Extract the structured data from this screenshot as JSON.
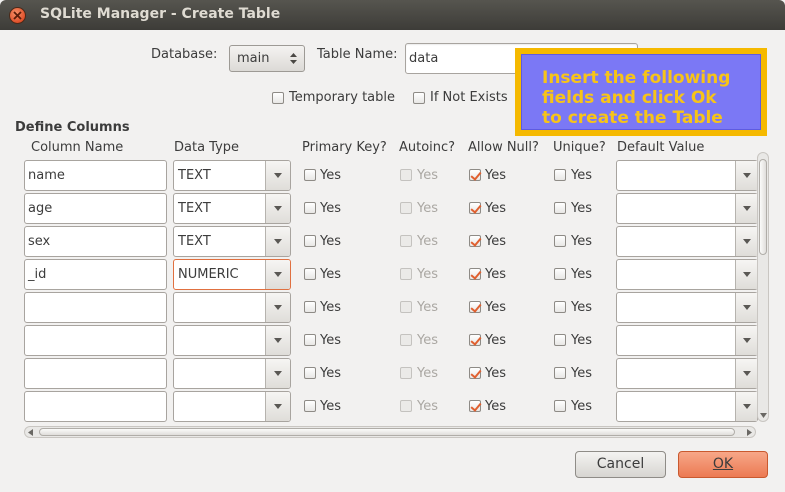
{
  "window": {
    "title": "SQLite Manager - Create Table"
  },
  "form": {
    "database_label": "Database:",
    "database_value": "main",
    "table_name_label": "Table Name:",
    "table_name_value": "data",
    "temporary_label": "Temporary table",
    "if_not_exists_label": "If Not Exists"
  },
  "tooltip": {
    "text": "Insert the following\nfields and click Ok\nto create the Table"
  },
  "columns_section": {
    "title": "Define Columns",
    "headers": [
      "Column Name",
      "Data Type",
      "Primary Key?",
      "Autoinc?",
      "Allow Null?",
      "Unique?",
      "Default Value"
    ],
    "yes_label": "Yes",
    "rows": [
      {
        "name": "name",
        "type": "TEXT",
        "primary_key": false,
        "autoinc": false,
        "allow_null": true,
        "unique": false,
        "default": ""
      },
      {
        "name": "age",
        "type": "TEXT",
        "primary_key": false,
        "autoinc": false,
        "allow_null": true,
        "unique": false,
        "default": ""
      },
      {
        "name": "sex",
        "type": "TEXT",
        "primary_key": false,
        "autoinc": false,
        "allow_null": true,
        "unique": false,
        "default": ""
      },
      {
        "name": "_id",
        "type": "NUMERIC",
        "primary_key": false,
        "autoinc": false,
        "allow_null": true,
        "unique": false,
        "default": ""
      },
      {
        "name": "",
        "type": "",
        "primary_key": false,
        "autoinc": false,
        "allow_null": true,
        "unique": false,
        "default": ""
      },
      {
        "name": "",
        "type": "",
        "primary_key": false,
        "autoinc": false,
        "allow_null": true,
        "unique": false,
        "default": ""
      },
      {
        "name": "",
        "type": "",
        "primary_key": false,
        "autoinc": false,
        "allow_null": true,
        "unique": false,
        "default": ""
      },
      {
        "name": "",
        "type": "",
        "primary_key": false,
        "autoinc": false,
        "allow_null": true,
        "unique": false,
        "default": ""
      }
    ]
  },
  "buttons": {
    "cancel": "Cancel",
    "ok": "OK"
  },
  "colors": {
    "accent": "#ec7a53",
    "tooltip_bg": "#7b78f5",
    "tooltip_border": "#f5b900",
    "tooltip_text": "#f7c418"
  }
}
